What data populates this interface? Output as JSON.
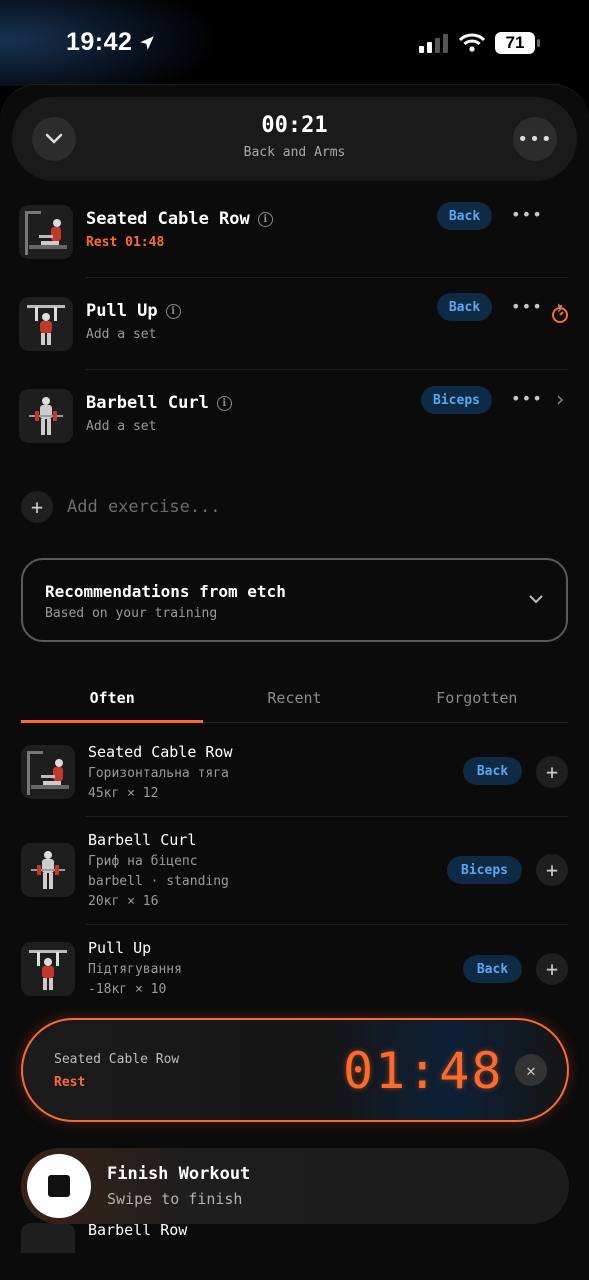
{
  "status_bar": {
    "time": "19:42",
    "battery": "71"
  },
  "header": {
    "timer": "00:21",
    "subtitle": "Back and Arms"
  },
  "workout_exercises": [
    {
      "name": "Seated Cable Row",
      "sub": "Rest 01:48",
      "tag": "Back"
    },
    {
      "name": "Pull Up",
      "sub": "Add a set",
      "tag": "Back"
    },
    {
      "name": "Barbell Curl",
      "sub": "Add a set",
      "tag": "Biceps"
    }
  ],
  "add_exercise": {
    "placeholder": "Add exercise..."
  },
  "recommendations": {
    "title": "Recommendations from etch",
    "subtitle": "Based on your training"
  },
  "tabs": [
    "Often",
    "Recent",
    "Forgotten"
  ],
  "recommended": [
    {
      "name": "Seated Cable Row",
      "lines": [
        "Горизонтальна тяга",
        "45кг × 12"
      ],
      "tag": "Back"
    },
    {
      "name": "Barbell Curl",
      "lines": [
        "Гриф на біцепс",
        "barbell · standing",
        "20кг × 16"
      ],
      "tag": "Biceps"
    },
    {
      "name": "Pull Up",
      "lines": [
        "Підтягування",
        "-18кг × 10"
      ],
      "tag": "Back"
    }
  ],
  "peek": {
    "name": "Barbell Row"
  },
  "rest_timer": {
    "exercise": "Seated Cable Row",
    "label": "Rest",
    "time": "01:48",
    "progress": 0.85
  },
  "finish": {
    "title": "Finish Workout",
    "subtitle": "Swipe to finish"
  },
  "colors": {
    "accent": "#ff6a2b",
    "tag_text": "#5aa8f0",
    "tag_bg": "#0f2a44"
  }
}
